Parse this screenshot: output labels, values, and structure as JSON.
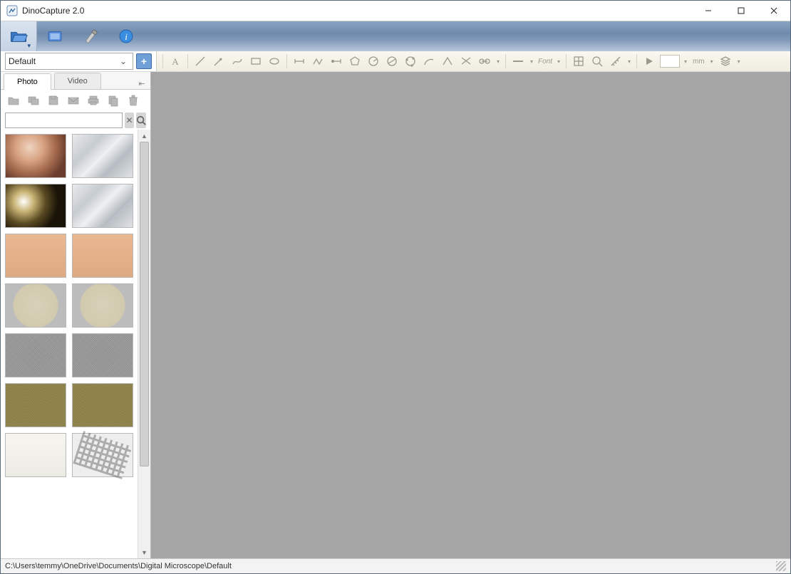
{
  "window": {
    "title": "DinoCapture 2.0"
  },
  "profile": {
    "selected": "Default"
  },
  "tabs": {
    "photo": "Photo",
    "video": "Video"
  },
  "search": {
    "value": "",
    "placeholder": ""
  },
  "units_label": "mm",
  "font_label": "Font",
  "statusbar": {
    "path": "C:\\Users\\temmy\\OneDrive\\Documents\\Digital Microscope\\Default"
  },
  "main_tools": {
    "folder": "open-folder",
    "camera": "live-preview",
    "tools": "settings-tools",
    "info": "about"
  },
  "thumbnails": [
    {
      "name": "thumb-1",
      "texture": "tx-ring"
    },
    {
      "name": "thumb-2",
      "texture": "tx-crystal"
    },
    {
      "name": "thumb-3",
      "texture": "tx-shiny"
    },
    {
      "name": "thumb-4",
      "texture": "tx-crystal"
    },
    {
      "name": "thumb-5",
      "texture": "tx-skin"
    },
    {
      "name": "thumb-6",
      "texture": "tx-skin"
    },
    {
      "name": "thumb-7",
      "texture": "tx-disc"
    },
    {
      "name": "thumb-8",
      "texture": "tx-disc"
    },
    {
      "name": "thumb-9",
      "texture": "tx-noise1"
    },
    {
      "name": "thumb-10",
      "texture": "tx-noise1"
    },
    {
      "name": "thumb-11",
      "texture": "tx-noise2"
    },
    {
      "name": "thumb-12",
      "texture": "tx-noise2"
    },
    {
      "name": "thumb-13",
      "texture": "tx-ruler"
    },
    {
      "name": "thumb-14",
      "texture": "tx-qr"
    }
  ]
}
